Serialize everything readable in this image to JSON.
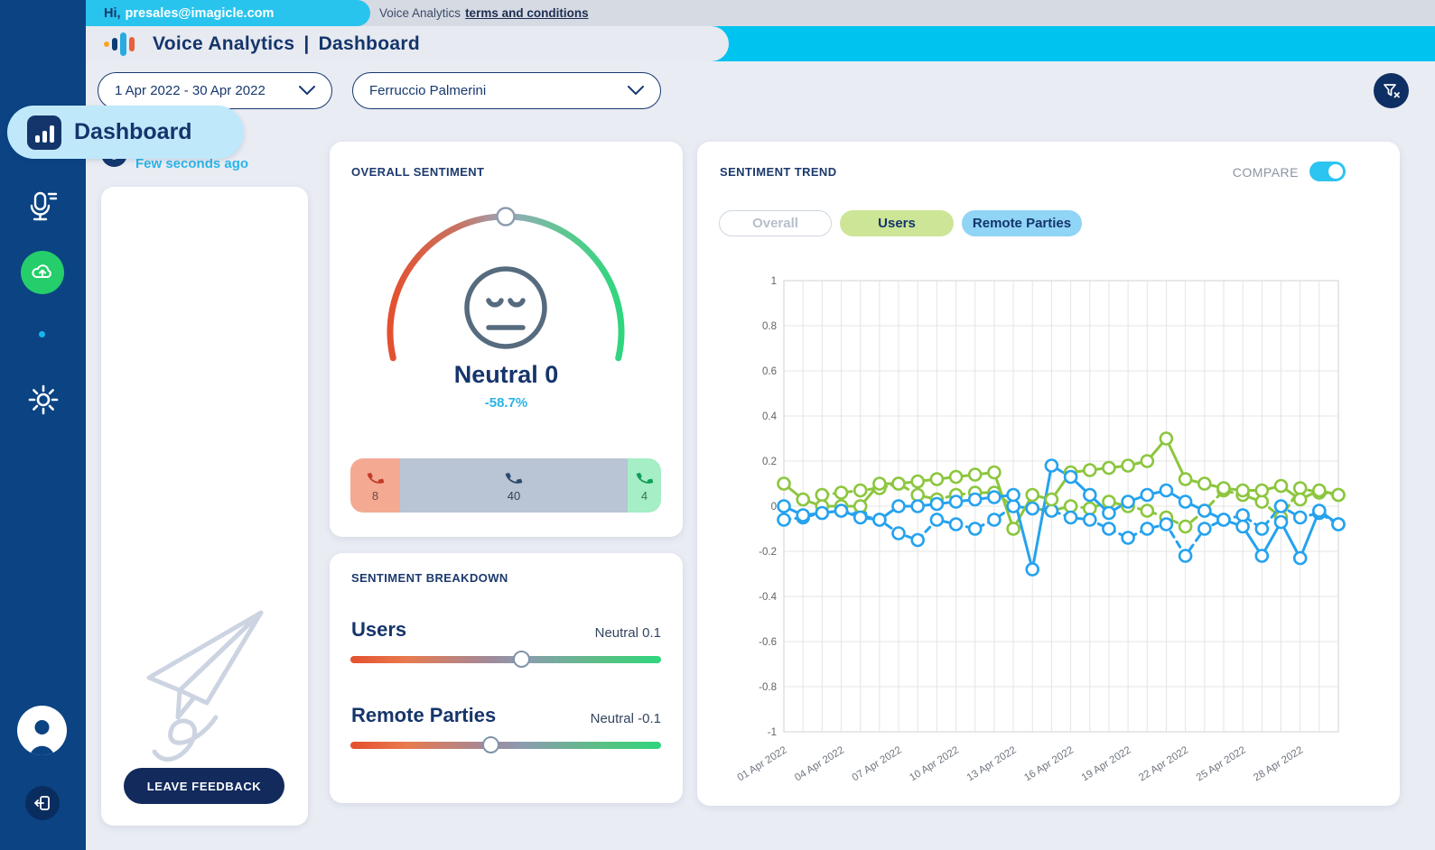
{
  "topbar": {
    "greeting_prefix": "Hi,",
    "user_email": "presales@imagicle.com",
    "app_text": "Voice Analytics",
    "terms_link": "terms and conditions"
  },
  "header": {
    "app_name": "Voice Analytics",
    "separator": "|",
    "page": "Dashboard"
  },
  "sidebar": {
    "active_label": "Dashboard"
  },
  "filters": {
    "date_range": "1 Apr 2022 - 30 Apr 2022",
    "user": "Ferruccio Palmerini"
  },
  "refresh": {
    "last_updated": "Few seconds ago"
  },
  "feedback": {
    "button_label": "LEAVE FEEDBACK"
  },
  "overall_sentiment": {
    "title": "OVERALL SENTIMENT",
    "label": "Neutral 0",
    "delta": "-58.7%",
    "gauge_value": 0,
    "calls": {
      "negative": 8,
      "neutral": 40,
      "positive": 4
    }
  },
  "sentiment_breakdown": {
    "title": "SENTIMENT BREAKDOWN",
    "rows": [
      {
        "label": "Users",
        "value_label": "Neutral 0.1",
        "value": 0.1
      },
      {
        "label": "Remote Parties",
        "value_label": "Neutral -0.1",
        "value": -0.1
      }
    ]
  },
  "sentiment_trend": {
    "title": "SENTIMENT TREND",
    "compare_label": "COMPARE",
    "compare_on": true,
    "tabs": [
      {
        "label": "Overall",
        "active": false
      },
      {
        "label": "Users",
        "active": true,
        "color": "#cde596"
      },
      {
        "label": "Remote Parties",
        "active": true,
        "color": "#90d4f6"
      }
    ]
  },
  "chart_data": {
    "type": "line",
    "title": "Sentiment trend 1-30 Apr 2022",
    "ylim": [
      -1,
      1
    ],
    "yticks": [
      1,
      0.8,
      0.6,
      0.4,
      0.2,
      0,
      -0.2,
      -0.4,
      -0.6,
      -0.8,
      -1
    ],
    "x_count": 30,
    "tick_days": [
      1,
      4,
      7,
      10,
      13,
      16,
      19,
      22,
      25,
      28
    ],
    "tick_labels": [
      "01 Apr 2022",
      "04 Apr 2022",
      "07 Apr 2022",
      "10 Apr 2022",
      "13 Apr 2022",
      "16 Apr 2022",
      "19 Apr 2022",
      "22 Apr 2022",
      "25 Apr 2022",
      "28 Apr 2022"
    ],
    "grid": true,
    "legend_position": "none",
    "series": [
      {
        "name": "Users",
        "style": "dashed",
        "color": "#8cc63e",
        "values": [
          null,
          null,
          0.05,
          0.06,
          0.07,
          0.08,
          0.1,
          0.05,
          0.03,
          0.05,
          0.06,
          0.06,
          0.0,
          -0.01,
          -0.02,
          0.0,
          -0.01,
          0.02,
          0.0,
          -0.02,
          -0.05,
          -0.09,
          -0.02,
          0.07,
          0.05,
          0.02,
          -0.05,
          0.08,
          0.06,
          0.05
        ]
      },
      {
        "name": "Remote Parties",
        "style": "dashed",
        "color": "#25a2ee",
        "values": [
          -0.06,
          -0.05,
          -0.03,
          -0.02,
          -0.04,
          -0.06,
          -0.12,
          -0.15,
          -0.06,
          -0.08,
          -0.1,
          -0.06,
          0.0,
          -0.01,
          -0.02,
          -0.05,
          -0.06,
          -0.1,
          -0.14,
          -0.1,
          -0.08,
          -0.22,
          -0.1,
          -0.06,
          -0.04,
          -0.1,
          0.0,
          -0.05,
          -0.03,
          -0.08
        ]
      },
      {
        "name": "Users",
        "style": "solid",
        "color": "#8cc63e",
        "values": [
          0.1,
          0.03,
          0.0,
          0.0,
          0.0,
          0.1,
          0.1,
          0.11,
          0.12,
          0.13,
          0.14,
          0.15,
          -0.1,
          0.05,
          0.03,
          0.15,
          0.16,
          0.17,
          0.18,
          0.2,
          0.3,
          0.12,
          0.1,
          0.08,
          0.07,
          0.07,
          0.09,
          0.03,
          0.07,
          0.05
        ]
      },
      {
        "name": "Remote Parties",
        "style": "solid",
        "color": "#25a2ee",
        "values": [
          0.0,
          -0.04,
          -0.03,
          -0.02,
          -0.05,
          -0.06,
          0.0,
          0.0,
          0.01,
          0.02,
          0.03,
          0.04,
          0.05,
          -0.28,
          0.18,
          0.13,
          0.05,
          -0.03,
          0.02,
          0.05,
          0.07,
          0.02,
          -0.02,
          -0.06,
          -0.09,
          -0.22,
          -0.07,
          -0.23,
          -0.02,
          -0.08
        ]
      }
    ]
  },
  "colors": {
    "accent_cyan": "#00c3ef",
    "navy": "#14356b",
    "sidebar": "#0b4383",
    "chart_green": "#8cc63e",
    "chart_blue": "#25a2ee",
    "gauge_negative": "#e4502e",
    "gauge_positive": "#2fd67e",
    "segment_negative": "#f4aa92",
    "segment_neutral": "#b9c4d4",
    "segment_positive": "#a5eec6",
    "active_pill": "#bfe9fb",
    "toggle_on": "#2cc4f0"
  }
}
